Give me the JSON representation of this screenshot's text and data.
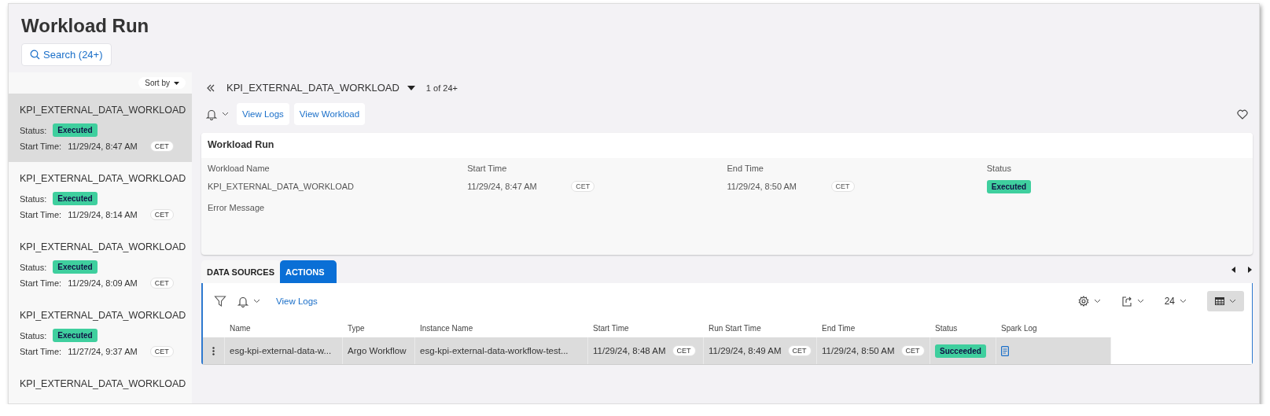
{
  "page": {
    "title": "Workload Run",
    "search_button": "Search (24+)"
  },
  "sidebar": {
    "sort_label": "Sort by",
    "items": [
      {
        "name": "KPI_EXTERNAL_DATA_WORKLOAD",
        "status_label": "Status:",
        "status": "Executed",
        "start_label": "Start Time:",
        "start_time": "11/29/24, 8:47 AM",
        "timezone": "CET",
        "selected": true
      },
      {
        "name": "KPI_EXTERNAL_DATA_WORKLOAD",
        "status_label": "Status:",
        "status": "Executed",
        "start_label": "Start Time:",
        "start_time": "11/29/24, 8:14 AM",
        "timezone": "CET",
        "selected": false
      },
      {
        "name": "KPI_EXTERNAL_DATA_WORKLOAD",
        "status_label": "Status:",
        "status": "Executed",
        "start_label": "Start Time:",
        "start_time": "11/29/24, 8:09 AM",
        "timezone": "CET",
        "selected": false
      },
      {
        "name": "KPI_EXTERNAL_DATA_WORKLOAD",
        "status_label": "Status:",
        "status": "Executed",
        "start_label": "Start Time:",
        "start_time": "11/27/24, 9:37 AM",
        "timezone": "CET",
        "selected": false
      },
      {
        "name": "KPI_EXTERNAL_DATA_WORKLOAD",
        "selected": false
      }
    ]
  },
  "detail": {
    "workload": "KPI_EXTERNAL_DATA_WORKLOAD",
    "position": "1 of 24+",
    "buttons": [
      "View Logs",
      "View Workload"
    ],
    "card": {
      "title": "Workload Run",
      "fields": [
        {
          "kind": "text",
          "label": "Workload Name",
          "value": "KPI_EXTERNAL_DATA_WORKLOAD"
        },
        {
          "kind": "time",
          "label": "Start Time",
          "value": "11/29/24, 8:47 AM",
          "timezone": "CET"
        },
        {
          "kind": "time",
          "label": "End Time",
          "value": "11/29/24, 8:50 AM",
          "timezone": "CET"
        },
        {
          "kind": "badge",
          "label": "Status",
          "value": "Executed"
        }
      ],
      "error_label": "Error Message"
    }
  },
  "tabs": [
    {
      "label": "DATA SOURCES",
      "selected": false
    },
    {
      "label": "ACTIONS",
      "selected": true
    }
  ],
  "table": {
    "toolbar_link": "View Logs",
    "page_size": "24",
    "columns": [
      "Name",
      "Type",
      "Instance Name",
      "Start Time",
      "Run Start Time",
      "End Time",
      "Status",
      "Spark Log"
    ],
    "rows": [
      {
        "selected": true,
        "cells": [
          {
            "kind": "text",
            "value": "esg-kpi-external-data-w..."
          },
          {
            "kind": "text",
            "value": "Argo Workflow"
          },
          {
            "kind": "text",
            "value": "esg-kpi-external-data-workflow-test..."
          },
          {
            "kind": "time",
            "value": "11/29/24, 8:48 AM",
            "timezone": "CET"
          },
          {
            "kind": "time",
            "value": "11/29/24, 8:49 AM",
            "timezone": "CET"
          },
          {
            "kind": "time",
            "value": "11/29/24, 8:50 AM",
            "timezone": "CET"
          },
          {
            "kind": "badge",
            "value": "Succeeded"
          },
          {
            "kind": "log"
          }
        ]
      }
    ]
  }
}
